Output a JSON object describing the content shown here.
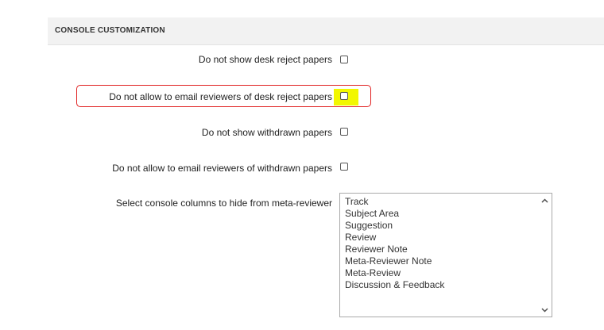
{
  "section": {
    "title": "CONSOLE CUSTOMIZATION"
  },
  "settings": [
    {
      "label": "Do not show desk reject papers",
      "checked": false
    },
    {
      "label": "Do not allow to email reviewers of desk reject papers",
      "checked": false,
      "highlighted": true
    },
    {
      "label": "Do not show withdrawn papers",
      "checked": false
    },
    {
      "label": "Do not allow to email reviewers of withdrawn papers",
      "checked": false
    }
  ],
  "hide_columns": {
    "label": "Select console columns to hide from meta-reviewer",
    "options": [
      "Track",
      "Subject Area",
      "Suggestion",
      "Review",
      "Reviewer Note",
      "Meta-Reviewer Note",
      "Meta-Review",
      "Discussion & Feedback"
    ]
  },
  "colors": {
    "highlight_outline": "#e02020",
    "highlight_marker": "#f2f700",
    "header_bg": "#f2f2f2"
  },
  "icons": {
    "scroll_up": "chevron-up-icon",
    "scroll_down": "chevron-down-icon"
  }
}
